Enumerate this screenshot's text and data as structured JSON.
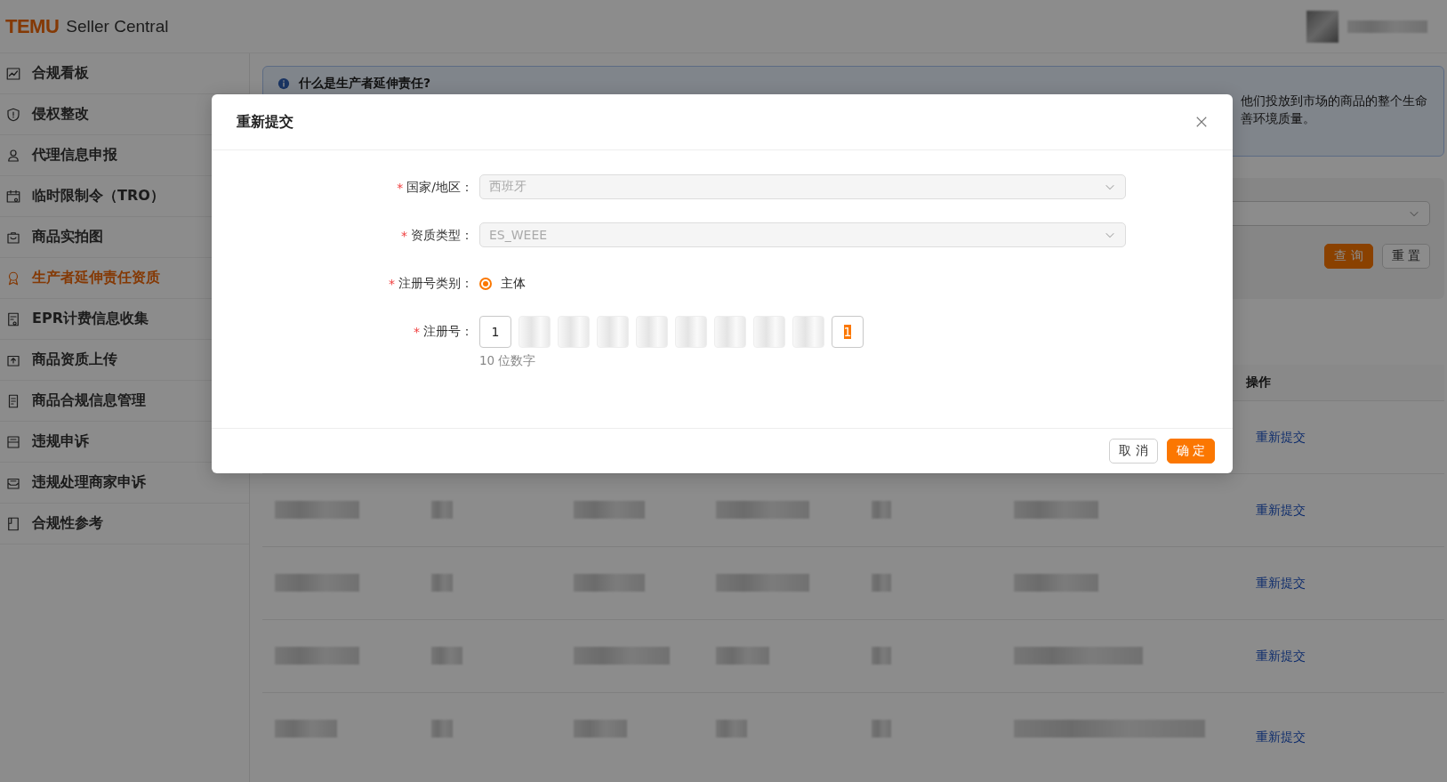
{
  "header": {
    "logo": "TEMU",
    "title": "Seller Central"
  },
  "sidebar": {
    "items": [
      {
        "label": "合规看板",
        "selected": false
      },
      {
        "label": "侵权整改",
        "selected": false
      },
      {
        "label": "代理信息申报",
        "selected": false
      },
      {
        "label": "临时限制令（TRO）",
        "selected": false
      },
      {
        "label": "商品实拍图",
        "selected": false
      },
      {
        "label": "生产者延伸责任资质",
        "selected": true
      },
      {
        "label": "EPR计费信息收集",
        "selected": false
      },
      {
        "label": "商品资质上传",
        "selected": false
      },
      {
        "label": "商品合规信息管理",
        "selected": false
      },
      {
        "label": "违规申诉",
        "selected": false
      },
      {
        "label": "违规处理商家申诉",
        "selected": false
      },
      {
        "label": "合规性参考",
        "selected": false
      }
    ]
  },
  "alert": {
    "title": "什么是生产者延伸责任?",
    "lines": [
      "他们投放到市场的商品的整个生命",
      "善环境质量。"
    ]
  },
  "filter": {
    "buttons": [
      {
        "label": "查 询",
        "kind": "primary"
      },
      {
        "label": "重 置",
        "kind": "default"
      }
    ]
  },
  "table": {
    "action_header": "操作",
    "rows": [
      {
        "action": "重新提交"
      },
      {
        "action": "重新提交"
      },
      {
        "action": "重新提交"
      },
      {
        "action": "重新提交"
      },
      {
        "action": "重新提交"
      }
    ]
  },
  "dialog": {
    "title": "重新提交",
    "fields": [
      {
        "kind": "select",
        "label": "国家/地区：",
        "required_mark": "*",
        "value": "西班牙",
        "disabled": true
      },
      {
        "kind": "select",
        "label": "资质类型：",
        "required_mark": "*",
        "value": "ES_WEEE",
        "disabled": true
      },
      {
        "kind": "radio",
        "label": "注册号类别：",
        "required_mark": "*",
        "options": [
          {
            "label": "主体",
            "selected": true
          }
        ]
      },
      {
        "kind": "digits",
        "label": "注册号：",
        "required_mark": "*",
        "hint": "10 位数字",
        "cells": [
          {
            "kind": "digit",
            "value": "1",
            "focused": false
          },
          {
            "kind": "blurred"
          },
          {
            "kind": "blurred"
          },
          {
            "kind": "blurred"
          },
          {
            "kind": "blurred"
          },
          {
            "kind": "blurred"
          },
          {
            "kind": "blurred"
          },
          {
            "kind": "blurred"
          },
          {
            "kind": "blurred"
          },
          {
            "kind": "digit",
            "value": "1",
            "focused": true
          }
        ]
      }
    ],
    "buttons": [
      {
        "label": "取 消",
        "kind": "default"
      },
      {
        "label": "确 定",
        "kind": "primary"
      }
    ]
  }
}
